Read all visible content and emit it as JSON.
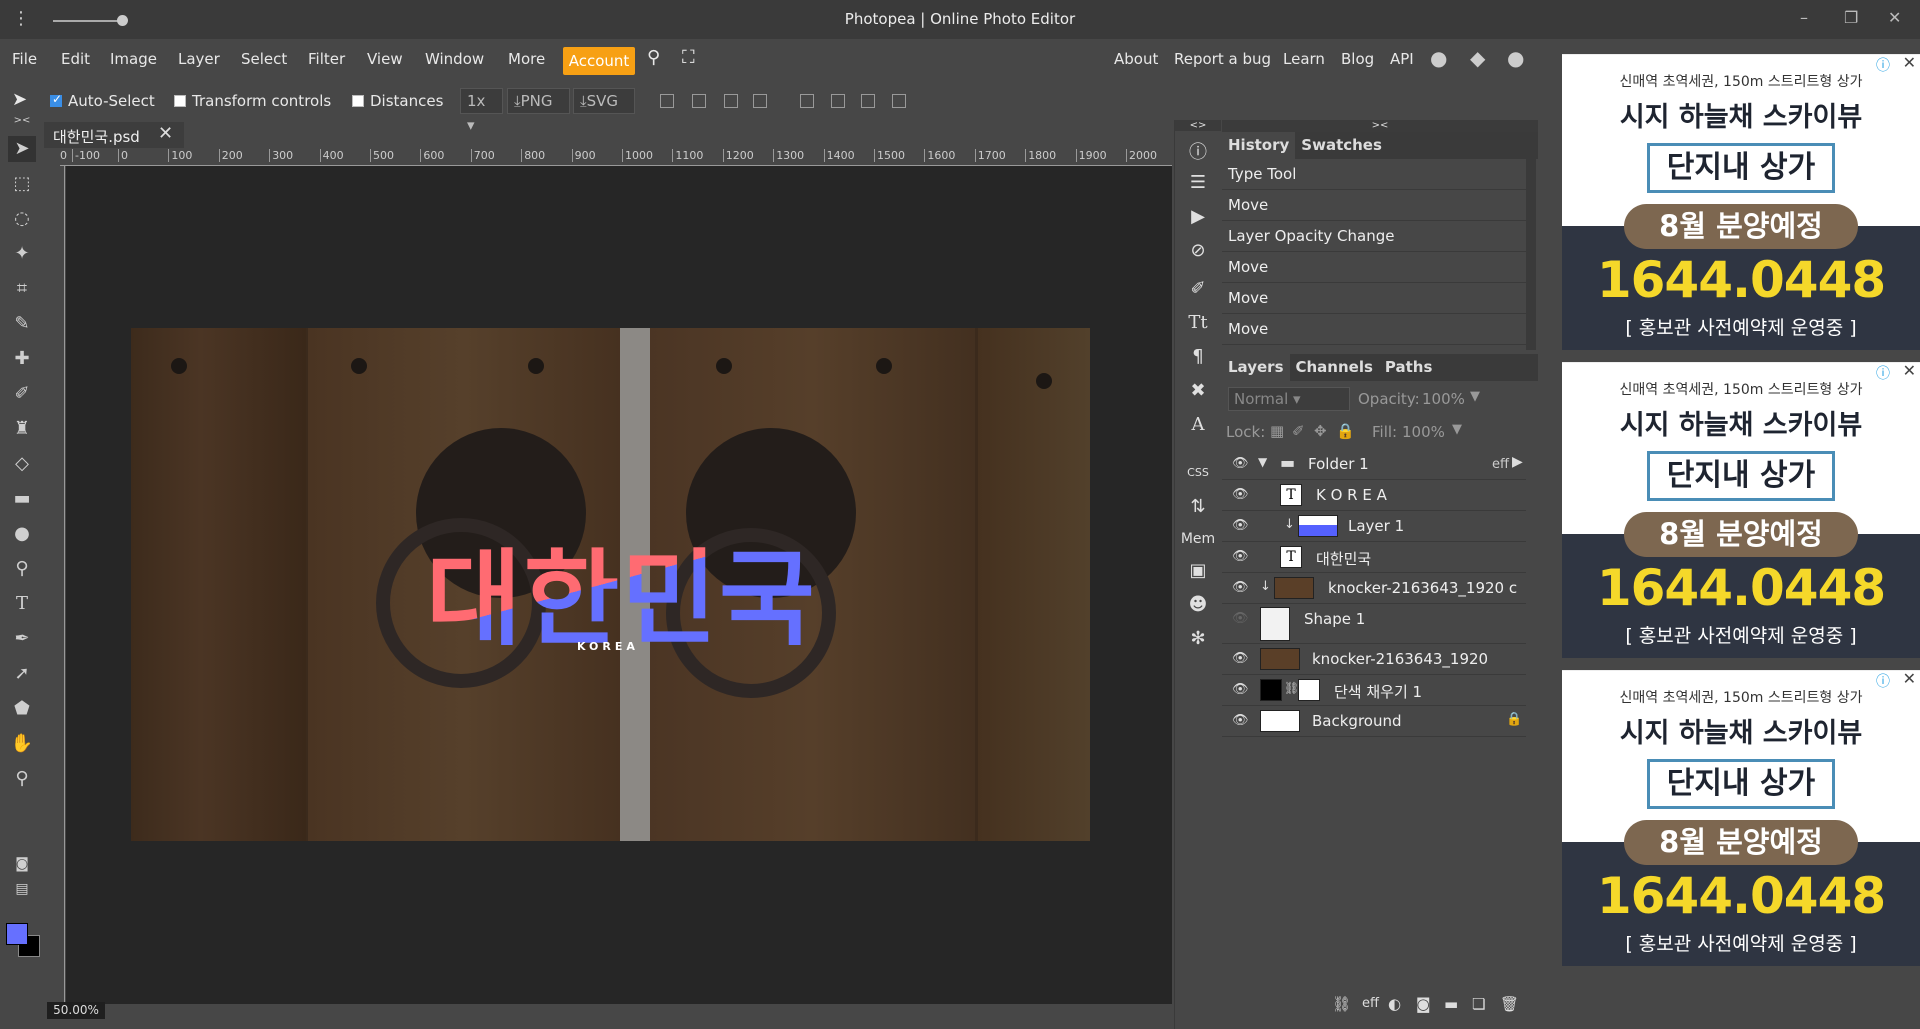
{
  "window": {
    "title": "Photopea | Online Photo Editor",
    "controls": [
      "–",
      "❐",
      "✕"
    ]
  },
  "menu": {
    "items": [
      "File",
      "Edit",
      "Image",
      "Layer",
      "Select",
      "Filter",
      "View",
      "Window",
      "More"
    ],
    "account_label": "Account",
    "right_links": [
      "About",
      "Report a bug",
      "Learn",
      "Blog",
      "API"
    ]
  },
  "options": {
    "auto_select": "Auto-Select",
    "transform_controls": "Transform controls",
    "distances": "Distances",
    "zoom_select": "1x",
    "png_label": "PNG",
    "svg_label": "SVG"
  },
  "document": {
    "tab_title": "대한민국.psd",
    "zoom_level": "50.00%",
    "ruler_ticks": [
      "00",
      "-100",
      "0",
      "100",
      "200",
      "300",
      "400",
      "500",
      "600",
      "700",
      "800",
      "900",
      "1000",
      "1100",
      "1200",
      "1300",
      "1400",
      "1500",
      "1600",
      "1700",
      "1800",
      "1900",
      "2000"
    ],
    "artwork_title": "대한민국",
    "artwork_subtitle": "KOREA"
  },
  "colors": {
    "foreground": "#6670ff",
    "background": "#000000",
    "accent": "#f7a014",
    "title_red": "#ff6b72",
    "title_blue": "#6570ff"
  },
  "history": {
    "tabs": [
      "History",
      "Swatches"
    ],
    "items": [
      "Type Tool",
      "Move",
      "Layer Opacity Change",
      "Move",
      "Move",
      "Move"
    ]
  },
  "layers": {
    "tabs": [
      "Layers",
      "Channels",
      "Paths"
    ],
    "blend_mode": "Normal",
    "opacity_label": "Opacity:",
    "opacity": "100%",
    "lock_label": "Lock:",
    "fill_label": "Fill:",
    "fill": "100%",
    "folder_fx": "eff",
    "footer_fx": "eff",
    "mini_css": "CSS",
    "mini_mem": "Mem",
    "items": [
      {
        "name": "Folder 1"
      },
      {
        "name": "K O R E A"
      },
      {
        "name": "Layer 1"
      },
      {
        "name": "대한민국"
      },
      {
        "name": "knocker-2163643_1920 c"
      },
      {
        "name": "Shape 1"
      },
      {
        "name": "knocker-2163643_1920"
      },
      {
        "name": "단색 채우기 1"
      },
      {
        "name": "Background"
      }
    ]
  },
  "ads": {
    "line1": "신매역 초역세권, 150m 스트리트형 상가",
    "line2": "시지 하늘채 스카이뷰",
    "line3": "단지내 상가",
    "line4": "8월 분양예정",
    "phone": "1644.0448",
    "line5": "[ 홍보관 사전예약제 운영중 ]"
  }
}
